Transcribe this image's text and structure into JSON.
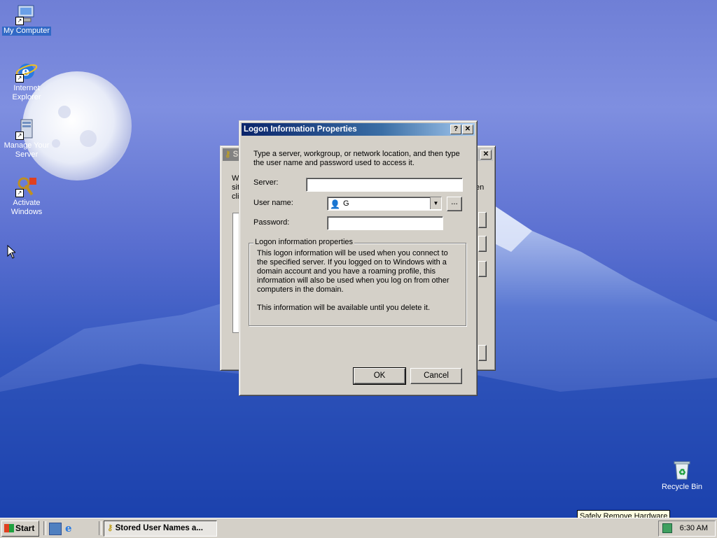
{
  "desktop": {
    "icons": [
      {
        "label": "My Computer",
        "icon": "my-computer-icon"
      },
      {
        "label": "Internet Explorer",
        "icon": "internet-explorer-icon"
      },
      {
        "label": "Manage Your Server",
        "icon": "manage-server-icon"
      },
      {
        "label": "Activate Windows",
        "icon": "activate-windows-icon"
      },
      {
        "label": "Recycle Bin",
        "icon": "recycle-bin-icon"
      }
    ]
  },
  "background_window": {
    "title": "S",
    "text_left": [
      "W",
      "sit",
      "cli"
    ],
    "text_right": "en"
  },
  "dialog": {
    "title": "Logon Information Properties",
    "help_glyph": "?",
    "close_glyph": "✕",
    "intro": "Type a server, workgroup, or network location, and then type the user name and password used to access it.",
    "server_label": "Server:",
    "server_value": "",
    "username_label": "User name:",
    "username_value": "G",
    "browse_label": "...",
    "password_label": "Password:",
    "password_value": "",
    "group_title": "Logon information properties",
    "group_text_1": "This logon information will be used when you connect to the specified server. If you logged on to Windows with a domain account and you have a roaming profile, this information will also be used when you log on from other computers in the domain.",
    "group_text_2": "This information will be available until you delete it.",
    "ok_label": "OK",
    "cancel_label": "Cancel"
  },
  "taskbar": {
    "start_label": "Start",
    "task_label": "Stored User Names a...",
    "clock": "6:30 AM",
    "tooltip": "Safely Remove Hardware"
  },
  "colors": {
    "title_active": "#0a246a",
    "face": "#d4d0c8",
    "selection": "#3169c6"
  }
}
